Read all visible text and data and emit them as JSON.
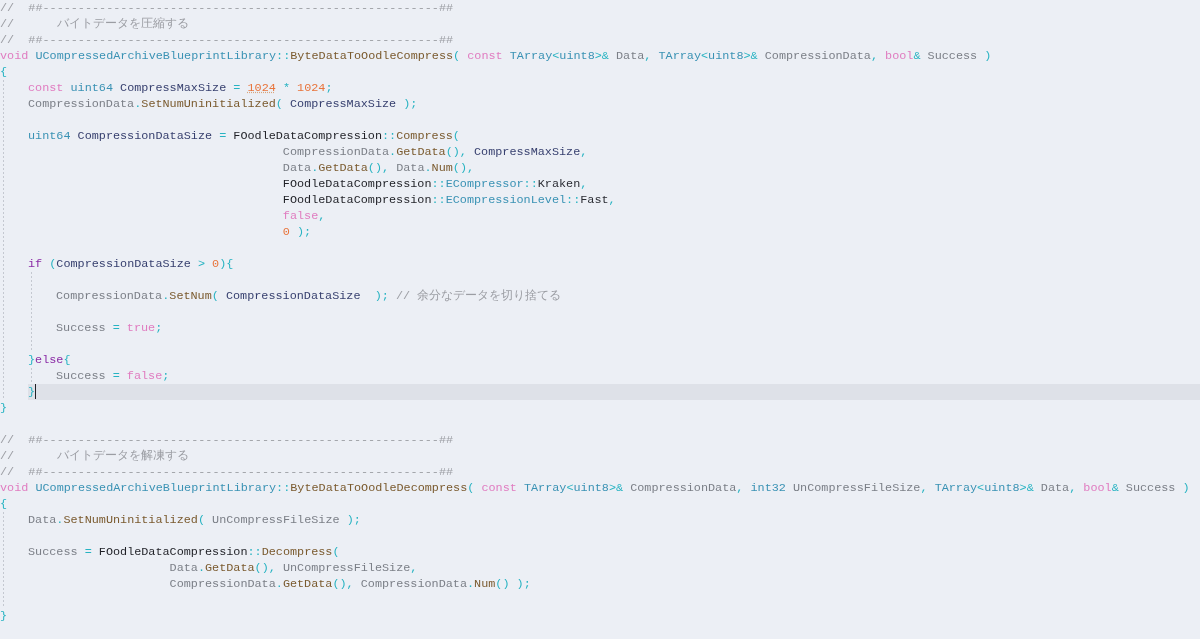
{
  "editor": {
    "lines": [
      {
        "current": false,
        "tokens": [
          {
            "kind": "comment",
            "text": "//  ##--------------------------------------------------------##"
          }
        ]
      },
      {
        "current": false,
        "tokens": [
          {
            "kind": "comment",
            "text": "//      バイトデータを圧縮する"
          }
        ]
      },
      {
        "current": false,
        "tokens": [
          {
            "kind": "comment",
            "text": "//  ##--------------------------------------------------------##"
          }
        ]
      },
      {
        "current": false,
        "tokens": [
          {
            "kind": "keyword",
            "text": "void "
          },
          {
            "kind": "type",
            "text": "UCompressedArchiveBlueprintLibrary"
          },
          {
            "kind": "punct",
            "text": "::"
          },
          {
            "kind": "func",
            "text": "ByteDataToOodleCompress"
          },
          {
            "kind": "punct",
            "text": "( "
          },
          {
            "kind": "keyword",
            "text": "const "
          },
          {
            "kind": "type",
            "text": "TArray"
          },
          {
            "kind": "punct",
            "text": "<"
          },
          {
            "kind": "type",
            "text": "uint8"
          },
          {
            "kind": "punct",
            "text": ">& "
          },
          {
            "kind": "param",
            "text": "Data"
          },
          {
            "kind": "punct",
            "text": ", "
          },
          {
            "kind": "type",
            "text": "TArray"
          },
          {
            "kind": "punct",
            "text": "<"
          },
          {
            "kind": "type",
            "text": "uint8"
          },
          {
            "kind": "punct",
            "text": ">& "
          },
          {
            "kind": "param",
            "text": "CompressionData"
          },
          {
            "kind": "punct",
            "text": ", "
          },
          {
            "kind": "keyword",
            "text": "bool"
          },
          {
            "kind": "punct",
            "text": "& "
          },
          {
            "kind": "param",
            "text": "Success"
          },
          {
            "kind": "punct",
            "text": " )"
          }
        ]
      },
      {
        "current": false,
        "tokens": [
          {
            "kind": "punct",
            "text": "{"
          }
        ],
        "children": [
          {
            "current": false,
            "tokens": [
              {
                "kind": "keyword",
                "text": "const "
              },
              {
                "kind": "type",
                "text": "uint64 "
              },
              {
                "kind": "local",
                "text": "CompressMaxSize"
              },
              {
                "kind": "punct",
                "text": " = "
              },
              {
                "kind": "hint_number",
                "text": "1024"
              },
              {
                "kind": "punct",
                "text": " * "
              },
              {
                "kind": "number",
                "text": "1024"
              },
              {
                "kind": "punct",
                "text": ";"
              }
            ]
          },
          {
            "current": false,
            "tokens": [
              {
                "kind": "param",
                "text": "CompressionData"
              },
              {
                "kind": "punct",
                "text": "."
              },
              {
                "kind": "func",
                "text": "SetNumUninitialized"
              },
              {
                "kind": "punct",
                "text": "( "
              },
              {
                "kind": "local",
                "text": "CompressMaxSize"
              },
              {
                "kind": "punct",
                "text": " );"
              }
            ]
          },
          {
            "current": false
          },
          {
            "current": false,
            "tokens": [
              {
                "kind": "type",
                "text": "uint64 "
              },
              {
                "kind": "local",
                "text": "CompressionDataSize"
              },
              {
                "kind": "punct",
                "text": " = "
              },
              {
                "kind": "class",
                "text": "FOodleDataCompression"
              },
              {
                "kind": "punct",
                "text": "::"
              },
              {
                "kind": "func",
                "text": "Compress"
              },
              {
                "kind": "punct",
                "text": "("
              }
            ]
          },
          {
            "current": false,
            "tokens": [
              {
                "kind": "param",
                "text": "                                    CompressionData"
              },
              {
                "kind": "punct",
                "text": "."
              },
              {
                "kind": "func",
                "text": "GetData"
              },
              {
                "kind": "punct",
                "text": "(), "
              },
              {
                "kind": "local",
                "text": "CompressMaxSize"
              },
              {
                "kind": "punct",
                "text": ","
              }
            ]
          },
          {
            "current": false,
            "tokens": [
              {
                "kind": "param",
                "text": "                                    Data"
              },
              {
                "kind": "punct",
                "text": "."
              },
              {
                "kind": "func",
                "text": "GetData"
              },
              {
                "kind": "punct",
                "text": "(), "
              },
              {
                "kind": "param",
                "text": "Data"
              },
              {
                "kind": "punct",
                "text": "."
              },
              {
                "kind": "func",
                "text": "Num"
              },
              {
                "kind": "punct",
                "text": "(),"
              }
            ]
          },
          {
            "current": false,
            "tokens": [
              {
                "kind": "class",
                "text": "                                    FOodleDataCompression"
              },
              {
                "kind": "punct",
                "text": "::"
              },
              {
                "kind": "type",
                "text": "ECompressor"
              },
              {
                "kind": "punct",
                "text": "::"
              },
              {
                "kind": "member",
                "text": "Kraken"
              },
              {
                "kind": "punct",
                "text": ","
              }
            ]
          },
          {
            "current": false,
            "tokens": [
              {
                "kind": "class",
                "text": "                                    FOodleDataCompression"
              },
              {
                "kind": "punct",
                "text": "::"
              },
              {
                "kind": "type",
                "text": "ECompressionLevel"
              },
              {
                "kind": "punct",
                "text": "::"
              },
              {
                "kind": "member",
                "text": "Fast"
              },
              {
                "kind": "punct",
                "text": ","
              }
            ]
          },
          {
            "current": false,
            "tokens": [
              {
                "kind": "keyword",
                "text": "                                    false"
              },
              {
                "kind": "punct",
                "text": ","
              }
            ]
          },
          {
            "current": false,
            "tokens": [
              {
                "kind": "number",
                "text": "                                    0"
              },
              {
                "kind": "punct",
                "text": " );"
              }
            ]
          },
          {
            "current": false
          },
          {
            "current": false,
            "tokens": [
              {
                "kind": "control",
                "text": "if"
              },
              {
                "kind": "punct",
                "text": " ("
              },
              {
                "kind": "local",
                "text": "CompressionDataSize"
              },
              {
                "kind": "punct",
                "text": " > "
              },
              {
                "kind": "number",
                "text": "0"
              },
              {
                "kind": "punct",
                "text": "){"
              }
            ],
            "children": [
              {
                "current": false
              },
              {
                "current": false,
                "tokens": [
                  {
                    "kind": "param",
                    "text": "CompressionData"
                  },
                  {
                    "kind": "punct",
                    "text": "."
                  },
                  {
                    "kind": "func",
                    "text": "SetNum"
                  },
                  {
                    "kind": "punct",
                    "text": "( "
                  },
                  {
                    "kind": "local",
                    "text": "CompressionDataSize"
                  },
                  {
                    "kind": "punct",
                    "text": "  ); "
                  },
                  {
                    "kind": "comment",
                    "text": "// 余分なデータを切り捨てる"
                  }
                ]
              },
              {
                "current": false
              },
              {
                "current": false,
                "tokens": [
                  {
                    "kind": "param",
                    "text": "Success"
                  },
                  {
                    "kind": "punct",
                    "text": " = "
                  },
                  {
                    "kind": "keyword",
                    "text": "true"
                  },
                  {
                    "kind": "punct",
                    "text": ";"
                  }
                ]
              },
              {
                "current": false
              }
            ]
          },
          {
            "current": false,
            "tokens": [
              {
                "kind": "punct",
                "text": "}"
              },
              {
                "kind": "control",
                "text": "else"
              },
              {
                "kind": "punct",
                "text": "{"
              }
            ],
            "children": [
              {
                "current": false,
                "tokens": [
                  {
                    "kind": "param",
                    "text": "Success"
                  },
                  {
                    "kind": "punct",
                    "text": " = "
                  },
                  {
                    "kind": "keyword",
                    "text": "false"
                  },
                  {
                    "kind": "punct",
                    "text": ";"
                  }
                ]
              }
            ]
          },
          {
            "current": true,
            "tokens": [
              {
                "kind": "punct",
                "text": "}"
              }
            ]
          }
        ]
      },
      {
        "current": false,
        "tokens": [
          {
            "kind": "punct",
            "text": "}"
          }
        ]
      },
      {
        "current": false
      },
      {
        "current": false,
        "tokens": [
          {
            "kind": "comment",
            "text": "//  ##--------------------------------------------------------##"
          }
        ]
      },
      {
        "current": false,
        "tokens": [
          {
            "kind": "comment",
            "text": "//      バイトデータを解凍する"
          }
        ]
      },
      {
        "current": false,
        "tokens": [
          {
            "kind": "comment",
            "text": "//  ##--------------------------------------------------------##"
          }
        ]
      },
      {
        "current": false,
        "tokens": [
          {
            "kind": "keyword",
            "text": "void "
          },
          {
            "kind": "type",
            "text": "UCompressedArchiveBlueprintLibrary"
          },
          {
            "kind": "punct",
            "text": "::"
          },
          {
            "kind": "func",
            "text": "ByteDataToOodleDecompress"
          },
          {
            "kind": "punct",
            "text": "( "
          },
          {
            "kind": "keyword",
            "text": "const "
          },
          {
            "kind": "type",
            "text": "TArray"
          },
          {
            "kind": "punct",
            "text": "<"
          },
          {
            "kind": "type",
            "text": "uint8"
          },
          {
            "kind": "punct",
            "text": ">& "
          },
          {
            "kind": "param",
            "text": "CompressionData"
          },
          {
            "kind": "punct",
            "text": ", "
          },
          {
            "kind": "type",
            "text": "int32 "
          },
          {
            "kind": "param",
            "text": "UnCompressFileSize"
          },
          {
            "kind": "punct",
            "text": ", "
          },
          {
            "kind": "type",
            "text": "TArray"
          },
          {
            "kind": "punct",
            "text": "<"
          },
          {
            "kind": "type",
            "text": "uint8"
          },
          {
            "kind": "punct",
            "text": ">& "
          },
          {
            "kind": "param",
            "text": "Data"
          },
          {
            "kind": "punct",
            "text": ", "
          },
          {
            "kind": "keyword",
            "text": "bool"
          },
          {
            "kind": "punct",
            "text": "& "
          },
          {
            "kind": "param",
            "text": "Success"
          },
          {
            "kind": "punct",
            "text": " )"
          }
        ]
      },
      {
        "current": false,
        "tokens": [
          {
            "kind": "punct",
            "text": "{"
          }
        ],
        "children": [
          {
            "current": false,
            "tokens": [
              {
                "kind": "param",
                "text": "Data"
              },
              {
                "kind": "punct",
                "text": "."
              },
              {
                "kind": "func",
                "text": "SetNumUninitialized"
              },
              {
                "kind": "punct",
                "text": "( "
              },
              {
                "kind": "param",
                "text": "UnCompressFileSize"
              },
              {
                "kind": "punct",
                "text": " );"
              }
            ]
          },
          {
            "current": false
          },
          {
            "current": false,
            "tokens": [
              {
                "kind": "param",
                "text": "Success"
              },
              {
                "kind": "punct",
                "text": " = "
              },
              {
                "kind": "class",
                "text": "FOodleDataCompression"
              },
              {
                "kind": "punct",
                "text": "::"
              },
              {
                "kind": "func",
                "text": "Decompress"
              },
              {
                "kind": "punct",
                "text": "("
              }
            ]
          },
          {
            "current": false,
            "tokens": [
              {
                "kind": "param",
                "text": "                    Data"
              },
              {
                "kind": "punct",
                "text": "."
              },
              {
                "kind": "func",
                "text": "GetData"
              },
              {
                "kind": "punct",
                "text": "(), "
              },
              {
                "kind": "param",
                "text": "UnCompressFileSize"
              },
              {
                "kind": "punct",
                "text": ","
              }
            ]
          },
          {
            "current": false,
            "tokens": [
              {
                "kind": "param",
                "text": "                    CompressionData"
              },
              {
                "kind": "punct",
                "text": "."
              },
              {
                "kind": "func",
                "text": "GetData"
              },
              {
                "kind": "punct",
                "text": "(), "
              },
              {
                "kind": "param",
                "text": "CompressionData"
              },
              {
                "kind": "punct",
                "text": "."
              },
              {
                "kind": "func",
                "text": "Num"
              },
              {
                "kind": "punct",
                "text": "() );"
              }
            ]
          },
          {
            "current": false
          }
        ]
      },
      {
        "current": false,
        "tokens": [
          {
            "kind": "punct",
            "text": "}"
          }
        ]
      }
    ]
  }
}
